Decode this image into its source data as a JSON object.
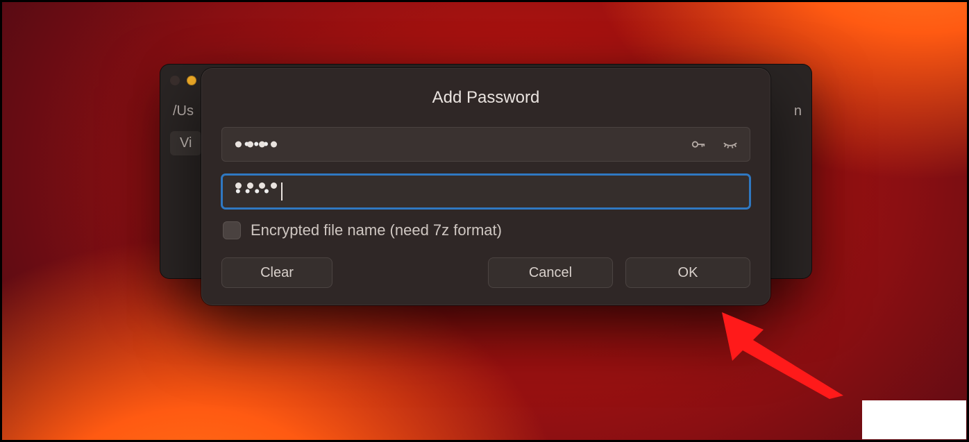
{
  "dialog": {
    "title": "Add Password",
    "password_value": "••••",
    "confirm_value": "••••",
    "encrypt_label": "Encrypted file name (need 7z format)",
    "encrypt_checked": false,
    "buttons": {
      "clear": "Clear",
      "cancel": "Cancel",
      "ok": "OK"
    },
    "icons": {
      "key": "key-icon",
      "eye": "eye-closed-icon"
    }
  },
  "back_window": {
    "path_prefix": "/Us",
    "chip": "Vi",
    "right_hint": "n"
  },
  "annotation": {
    "target": "ok-button",
    "color": "#ff1a1a"
  }
}
